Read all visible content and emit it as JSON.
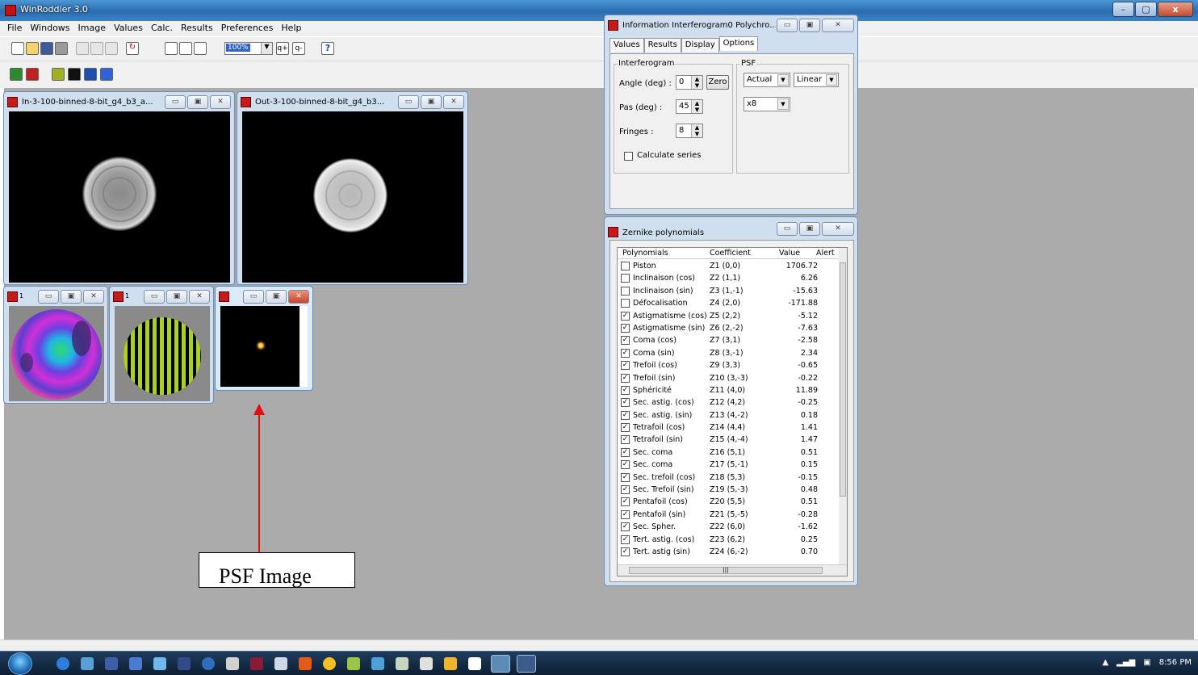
{
  "app": {
    "title": "WinRoddier 3.0",
    "caption_buttons": [
      "–",
      "▢",
      "x"
    ]
  },
  "menu": [
    "File",
    "Windows",
    "Image",
    "Values",
    "Calc.",
    "Results",
    "Preferences",
    "Help"
  ],
  "toolbar": {
    "zoom_value": "100%",
    "zoom_in_label": "q+",
    "zoom_out_label": "q-",
    "help_label": "?"
  },
  "windows": {
    "in_image": {
      "title": "In-3-100-binned-8-bit_g4_b3_a..."
    },
    "out_image": {
      "title": "Out-3-100-binned-8-bit_g4_b3..."
    },
    "phase_map": {
      "title": "1"
    },
    "interferogram": {
      "title": "1"
    },
    "psf": {
      "title": ""
    }
  },
  "info_window": {
    "title": "Information Interferogram0 Polychro...",
    "tabs": [
      "Values",
      "Results",
      "Display",
      "Options"
    ],
    "active_tab": "Options",
    "interferogram_group": "Interferogram",
    "psf_group": "PSF",
    "angle_label": "Angle (deg) :",
    "angle_value": "0",
    "zero_button": "Zero",
    "pas_label": "Pas (deg) :",
    "pas_value": "45",
    "fringes_label": "Fringes :",
    "fringes_value": "8",
    "calculate_series_label": "Calculate series",
    "psf_mode": "Actual",
    "psf_scale": "Linear",
    "psf_zoom": "x8"
  },
  "zernike_window": {
    "title": "Zernike polynomials",
    "columns": [
      "Polynomials",
      "Coefficient",
      "Value",
      "Alert"
    ],
    "rows": [
      {
        "name": "Piston",
        "coef": "Z1 (0,0)",
        "value": "1706.72",
        "checked": false
      },
      {
        "name": "Inclinaison (cos)",
        "coef": "Z2 (1,1)",
        "value": "6.26",
        "checked": false
      },
      {
        "name": "Inclinaison (sin)",
        "coef": "Z3 (1,-1)",
        "value": "-15.63",
        "checked": false
      },
      {
        "name": "Défocalisation",
        "coef": "Z4 (2,0)",
        "value": "-171.88",
        "checked": false
      },
      {
        "name": "Astigmatisme (cos)",
        "coef": "Z5 (2,2)",
        "value": "-5.12",
        "checked": true
      },
      {
        "name": "Astigmatisme (sin)",
        "coef": "Z6 (2,-2)",
        "value": "-7.63",
        "checked": true
      },
      {
        "name": "Coma (cos)",
        "coef": "Z7 (3,1)",
        "value": "-2.58",
        "checked": true
      },
      {
        "name": "Coma (sin)",
        "coef": "Z8 (3,-1)",
        "value": "2.34",
        "checked": true
      },
      {
        "name": "Trefoil (cos)",
        "coef": "Z9 (3,3)",
        "value": "-0.65",
        "checked": true
      },
      {
        "name": "Trefoil (sin)",
        "coef": "Z10 (3,-3)",
        "value": "-0.22",
        "checked": true
      },
      {
        "name": "Sphéricité",
        "coef": "Z11 (4,0)",
        "value": "11.89",
        "checked": true
      },
      {
        "name": "Sec. astig. (cos)",
        "coef": "Z12 (4,2)",
        "value": "-0.25",
        "checked": true
      },
      {
        "name": "Sec. astig. (sin)",
        "coef": "Z13 (4,-2)",
        "value": "0.18",
        "checked": true
      },
      {
        "name": "Tetrafoil (cos)",
        "coef": "Z14 (4,4)",
        "value": "1.41",
        "checked": true
      },
      {
        "name": "Tetrafoil (sin)",
        "coef": "Z15 (4,-4)",
        "value": "1.47",
        "checked": true
      },
      {
        "name": "Sec. coma",
        "coef": "Z16 (5,1)",
        "value": "0.51",
        "checked": true
      },
      {
        "name": "Sec. coma",
        "coef": "Z17 (5,-1)",
        "value": "0.15",
        "checked": true
      },
      {
        "name": "Sec. trefoil (cos)",
        "coef": "Z18 (5,3)",
        "value": "-0.15",
        "checked": true
      },
      {
        "name": "Sec. Trefoil (sin)",
        "coef": "Z19 (5,-3)",
        "value": "0.48",
        "checked": true
      },
      {
        "name": "Pentafoil (cos)",
        "coef": "Z20 (5,5)",
        "value": "0.51",
        "checked": true
      },
      {
        "name": "Pentafoil (sin)",
        "coef": "Z21 (5,-5)",
        "value": "-0.28",
        "checked": true
      },
      {
        "name": "Sec. Spher.",
        "coef": "Z22 (6,0)",
        "value": "-1.62",
        "checked": true
      },
      {
        "name": "Tert. astig. (cos)",
        "coef": "Z23 (6,2)",
        "value": "0.25",
        "checked": true
      },
      {
        "name": "Tert. astig (sin)",
        "coef": "Z24 (6,-2)",
        "value": "0.70",
        "checked": true
      }
    ]
  },
  "annotation": {
    "label": "PSF Image"
  },
  "taskbar": {
    "time": "8:56 PM"
  },
  "colors": {
    "mdi_background": "#ababab",
    "taskbar": "#1a334f",
    "arrow": "#e01010"
  }
}
